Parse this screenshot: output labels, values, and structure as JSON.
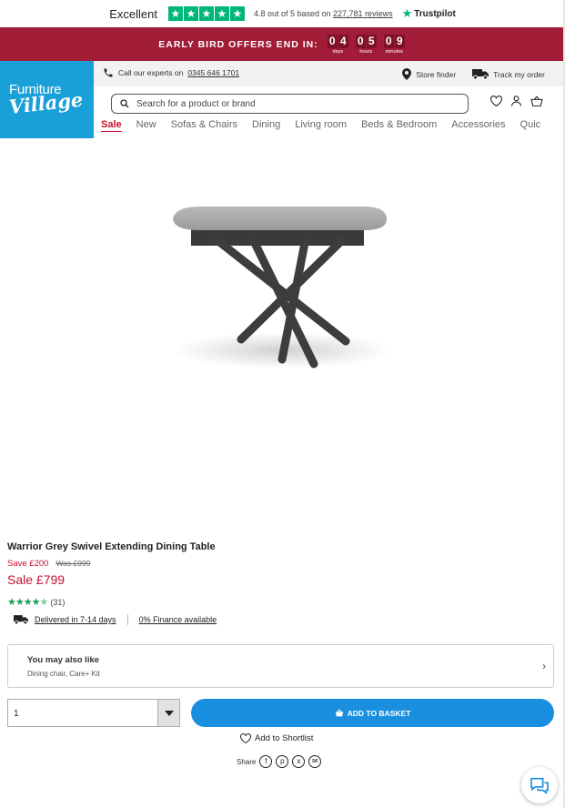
{
  "trustpilot": {
    "rating_word": "Excellent",
    "star_glyph": "★",
    "stars": 5,
    "summary_prefix": "4.8 out of 5 based on",
    "reviews_link": "227,781 reviews",
    "brand": "Trustpilot",
    "brand_color": "#00b67a"
  },
  "promo": {
    "text": "EARLY BIRD OFFERS END IN:",
    "background": "#a01c37",
    "countdown": [
      {
        "digits": [
          "0",
          "4"
        ],
        "label": "days"
      },
      {
        "digits": [
          "0",
          "5"
        ],
        "label": "hours"
      },
      {
        "digits": [
          "0",
          "9"
        ],
        "label": "minutes"
      }
    ]
  },
  "header": {
    "logo_line1": "Furniture",
    "logo_line2": "Village",
    "logo_color": "#1aa0d8",
    "call_text": "Call our experts on",
    "phone": "0345 646 1701",
    "store_finder": "Store finder",
    "track_order": "Track my order",
    "search_placeholder": "Search for a product or brand",
    "icons": [
      "phone-icon",
      "map-pin-icon",
      "truck-icon",
      "search-icon",
      "heart-icon",
      "user-icon",
      "basket-icon"
    ]
  },
  "nav": {
    "items": [
      "Sale",
      "New",
      "Sofas & Chairs",
      "Dining",
      "Living room",
      "Beds & Bedroom",
      "Accessories",
      "Quic"
    ]
  },
  "product": {
    "title": "Warrior Grey Swivel Extending Dining Table",
    "save": "Save £200",
    "was": "Was £999",
    "price": "Sale £799",
    "rating_stars": 4.5,
    "reviews_count": "(31)",
    "delivery": "Delivered in 7-14 days",
    "finance": "0% Finance available",
    "accent_color": "#c8102e"
  },
  "also_like": {
    "title": "You may also like",
    "subtitle": "Dining chair, Care+ Kit"
  },
  "purchase": {
    "quantity": "1",
    "add_to_basket": "ADD TO BASKET",
    "add_to_shortlist": "Add to Shortlist",
    "share_label": "Share",
    "share_icons": [
      "facebook-icon",
      "pinterest-icon",
      "x-icon",
      "email-icon"
    ],
    "button_color": "#1a8fe0"
  }
}
